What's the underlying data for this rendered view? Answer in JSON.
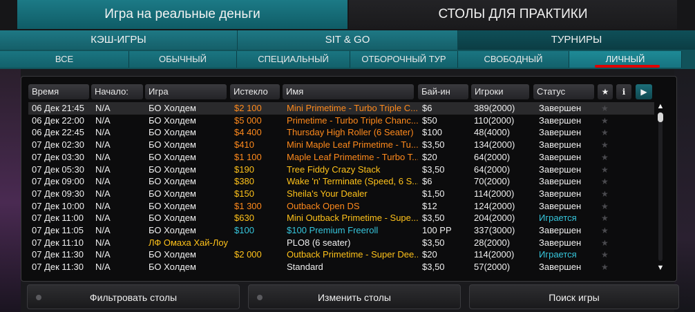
{
  "header": {
    "real_money_tab": "Игра на реальные деньги",
    "practice_tab": "СТОЛЫ ДЛЯ ПРАКТИКИ"
  },
  "game_types": [
    "КЭШ-ИГРЫ",
    "SIT & GO",
    "ТУРНИРЫ"
  ],
  "filters": [
    "ВСЕ",
    "ОБЫЧНЫЙ",
    "СПЕЦИАЛЬНЫЙ",
    "ОТБОРОЧНЫЙ ТУР",
    "СВОБОДНЫЙ",
    "ЛИЧНЫЙ"
  ],
  "table": {
    "columns": [
      "Время",
      "Начало:",
      "Игра",
      "Истекло",
      "Имя",
      "Бай-ин",
      "Игроки",
      "Статус"
    ],
    "header_icons": {
      "star": "★",
      "info": "ℹ",
      "play": "▶"
    },
    "rows": [
      {
        "time": "06 Дек 21:45",
        "start": "N/A",
        "game": "БО Холдем",
        "expired": "$2 100",
        "name": "Mini Primetime - Turbo Triple C...",
        "buyin": "$6",
        "players": "389(2000)",
        "status": "Завершен",
        "expired_color": "orange",
        "name_color": "orange",
        "status_color": "white",
        "game_color": "white"
      },
      {
        "time": "06 Дек 22:00",
        "start": "N/A",
        "game": "БО Холдем",
        "expired": "$5 000",
        "name": "Primetime - Turbo Triple Chanc...",
        "buyin": "$50",
        "players": "110(2000)",
        "status": "Завершен",
        "expired_color": "orange",
        "name_color": "orange",
        "status_color": "white",
        "game_color": "white"
      },
      {
        "time": "06 Дек 22:45",
        "start": "N/A",
        "game": "БО Холдем",
        "expired": "$4 400",
        "name": "Thursday High Roller (6 Seater)",
        "buyin": "$100",
        "players": "48(4000)",
        "status": "Завершен",
        "expired_color": "orange",
        "name_color": "orange",
        "status_color": "white",
        "game_color": "white"
      },
      {
        "time": "07 Дек 02:30",
        "start": "N/A",
        "game": "БО Холдем",
        "expired": "$410",
        "name": "Mini Maple Leaf Primetime - Tu...",
        "buyin": "$3,50",
        "players": "134(2000)",
        "status": "Завершен",
        "expired_color": "orange",
        "name_color": "orange",
        "status_color": "white",
        "game_color": "white"
      },
      {
        "time": "07 Дек 03:30",
        "start": "N/A",
        "game": "БО Холдем",
        "expired": "$1 100",
        "name": "Maple Leaf Primetime - Turbo T...",
        "buyin": "$20",
        "players": "64(2000)",
        "status": "Завершен",
        "expired_color": "orange",
        "name_color": "orange",
        "status_color": "white",
        "game_color": "white"
      },
      {
        "time": "07 Дек 05:30",
        "start": "N/A",
        "game": "БО Холдем",
        "expired": "$190",
        "name": "Tree Fiddy Crazy Stack",
        "buyin": "$3,50",
        "players": "64(2000)",
        "status": "Завершен",
        "expired_color": "yellow",
        "name_color": "yellow",
        "status_color": "white",
        "game_color": "white"
      },
      {
        "time": "07 Дек 09:00",
        "start": "N/A",
        "game": "БО Холдем",
        "expired": "$380",
        "name": "Wake 'n' Terminate (Speed, 6 S...",
        "buyin": "$6",
        "players": "70(2000)",
        "status": "Завершен",
        "expired_color": "yellow",
        "name_color": "yellow",
        "status_color": "white",
        "game_color": "white"
      },
      {
        "time": "07 Дек 09:30",
        "start": "N/A",
        "game": "БО Холдем",
        "expired": "$150",
        "name": "Sheila's Your Dealer",
        "buyin": "$1,50",
        "players": "114(2000)",
        "status": "Завершен",
        "expired_color": "yellow",
        "name_color": "yellow",
        "status_color": "white",
        "game_color": "white"
      },
      {
        "time": "07 Дек 10:00",
        "start": "N/A",
        "game": "БО Холдем",
        "expired": "$1 300",
        "name": "Outback Open DS",
        "buyin": "$12",
        "players": "124(2000)",
        "status": "Завершен",
        "expired_color": "orange",
        "name_color": "orange",
        "status_color": "white",
        "game_color": "white"
      },
      {
        "time": "07 Дек 11:00",
        "start": "N/A",
        "game": "БО Холдем",
        "expired": "$630",
        "name": "Mini Outback Primetime -  Supe...",
        "buyin": "$3,50",
        "players": "204(2000)",
        "status": "Играется",
        "expired_color": "yellow",
        "name_color": "yellow",
        "status_color": "cyan",
        "game_color": "white"
      },
      {
        "time": "07 Дек 11:05",
        "start": "N/A",
        "game": "БО Холдем",
        "expired": "$100",
        "name": "$100 Premium Freeroll",
        "buyin": "100 PP",
        "players": "337(3000)",
        "status": "Завершен",
        "expired_color": "cyan",
        "name_color": "cyan",
        "status_color": "white",
        "game_color": "white"
      },
      {
        "time": "07 Дек 11:10",
        "start": "N/A",
        "game": "ЛФ Омаха Хай-Лоу",
        "expired": "",
        "name": "PLO8 (6 seater)",
        "buyin": "$3,50",
        "players": "28(2000)",
        "status": "Завершен",
        "expired_color": "white",
        "name_color": "white",
        "status_color": "white",
        "game_color": "yellow"
      },
      {
        "time": "07 Дек 11:30",
        "start": "N/A",
        "game": "БО Холдем",
        "expired": "$2 000",
        "name": "Outback Primetime - Super Dee...",
        "buyin": "$20",
        "players": "114(2000)",
        "status": "Играется",
        "expired_color": "yellow",
        "name_color": "yellow",
        "status_color": "cyan",
        "game_color": "white"
      },
      {
        "time": "07 Дек 11:30",
        "start": "N/A",
        "game": "БО Холдем",
        "expired": "",
        "name": "Standard",
        "buyin": "$3,50",
        "players": "57(2000)",
        "status": "Завершен",
        "expired_color": "white",
        "name_color": "white",
        "status_color": "white",
        "game_color": "white"
      }
    ]
  },
  "buttons": {
    "filter": "Фильтровать столы",
    "change": "Изменить столы",
    "search": "Поиск игры"
  },
  "colors": {
    "accent": "#1b7a86",
    "orange": "#ff8a1c",
    "yellow": "#ffc21a",
    "cyan": "#36c6dc",
    "underline": "#e00000"
  }
}
